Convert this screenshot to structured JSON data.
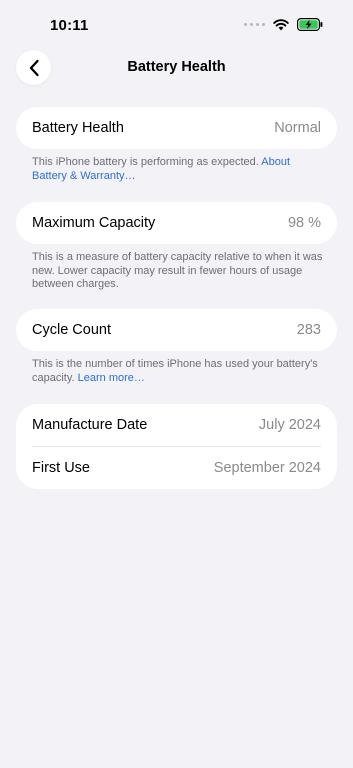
{
  "status": {
    "time": "10:11",
    "icons": [
      "signal-dots",
      "wifi-icon",
      "battery-charging-icon"
    ]
  },
  "nav": {
    "title": "Battery Health",
    "back_icon": "chevron-left-icon"
  },
  "health": {
    "label": "Battery Health",
    "value": "Normal"
  },
  "health_note": {
    "text": "This iPhone battery is performing as expected. ",
    "link": "About Battery & Warranty…"
  },
  "capacity": {
    "label": "Maximum Capacity",
    "value": "98 %"
  },
  "capacity_note": {
    "text": "This is a measure of battery capacity relative to when it was new. Lower capacity may result in fewer hours of usage between charges."
  },
  "cycle": {
    "label": "Cycle Count",
    "value": "283"
  },
  "cycle_note": {
    "text": "This is the number of times iPhone has used your battery's capacity. ",
    "link": "Learn more…"
  },
  "dates": {
    "manufacture_label": "Manufacture Date",
    "manufacture_value": "July 2024",
    "first_use_label": "First Use",
    "first_use_value": "September 2024"
  },
  "colors": {
    "background": "#f2f2f7",
    "link": "#2f6fd6",
    "battery": "#34c759"
  }
}
